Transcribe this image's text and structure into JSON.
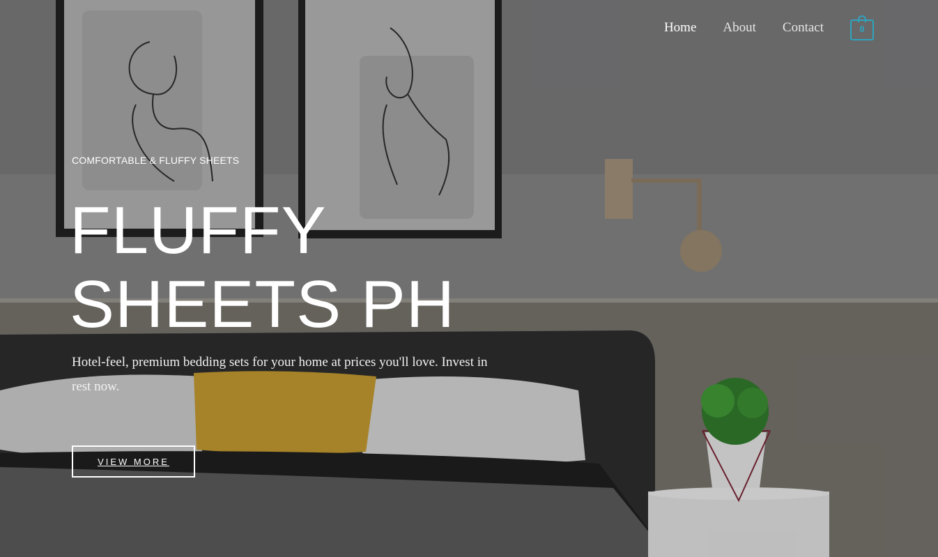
{
  "nav": {
    "items": [
      {
        "label": "Home",
        "active": true
      },
      {
        "label": "About",
        "active": false
      },
      {
        "label": "Contact",
        "active": false
      }
    ],
    "cart_count": "0",
    "accent_color": "#2ea4bf"
  },
  "hero": {
    "eyebrow": "COMFORTABLE & FLUFFY SHEETS",
    "headline_line1": "FLUFFY",
    "headline_line2": "SHEETS PH",
    "subtitle": "Hotel-feel, premium bedding sets for your home at prices you'll love. Invest in rest now.",
    "cta_label": "VIEW MORE"
  }
}
